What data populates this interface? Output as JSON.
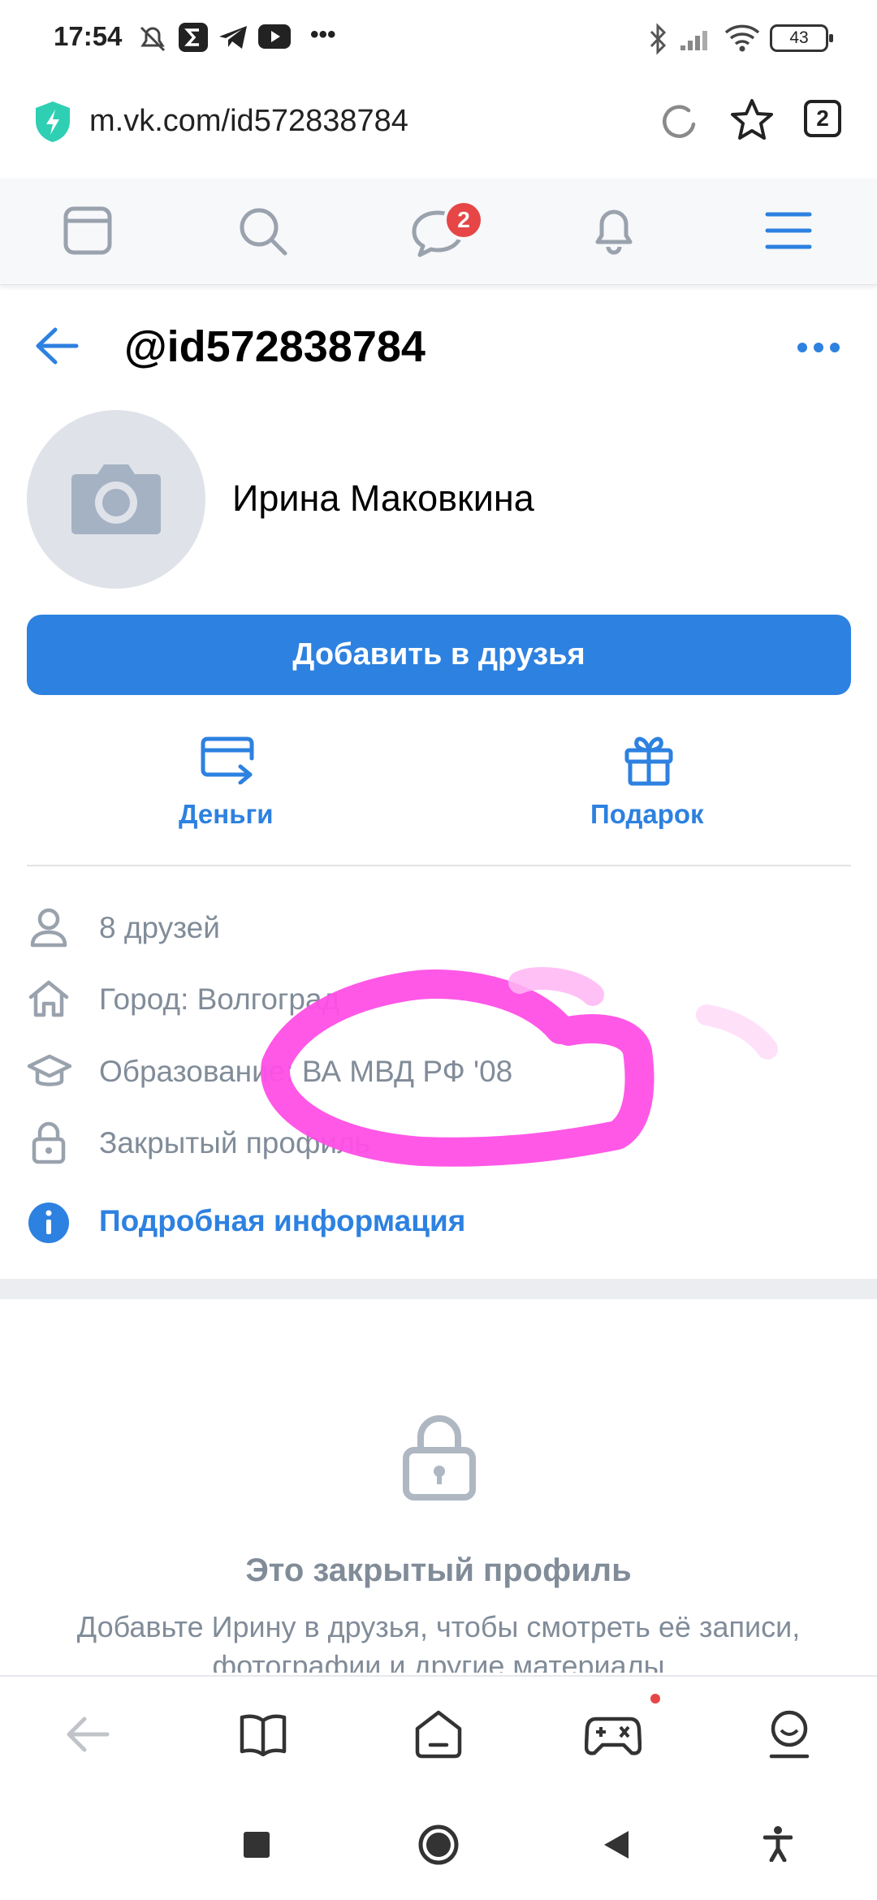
{
  "status_bar": {
    "time": "17:54",
    "more": "•••",
    "battery": "43"
  },
  "browser": {
    "url": "m.vk.com/id572838784",
    "tab_count": "2"
  },
  "toolbar": {
    "messages_badge": "2"
  },
  "profile": {
    "handle": "@id572838784",
    "name": "Ирина Маковкина",
    "add_friend_label": "Добавить в друзья",
    "actions": {
      "money": "Деньги",
      "gift": "Подарок"
    },
    "info": {
      "friends": "8 друзей",
      "city": "Город: Волгоград",
      "education": "Образование: ВА МВД РФ '08",
      "closed": "Закрытый профиль"
    },
    "details_link": "Подробная информация"
  },
  "closed_section": {
    "title": "Это закрытый профиль",
    "description": "Добавьте Ирину в друзья, чтобы смотреть её записи, фотографии и другие материалы"
  },
  "colors": {
    "accent": "#2d81e0",
    "secondary_text": "#818c99",
    "badge": "#e64646",
    "scribble": "#ff4fe6"
  }
}
